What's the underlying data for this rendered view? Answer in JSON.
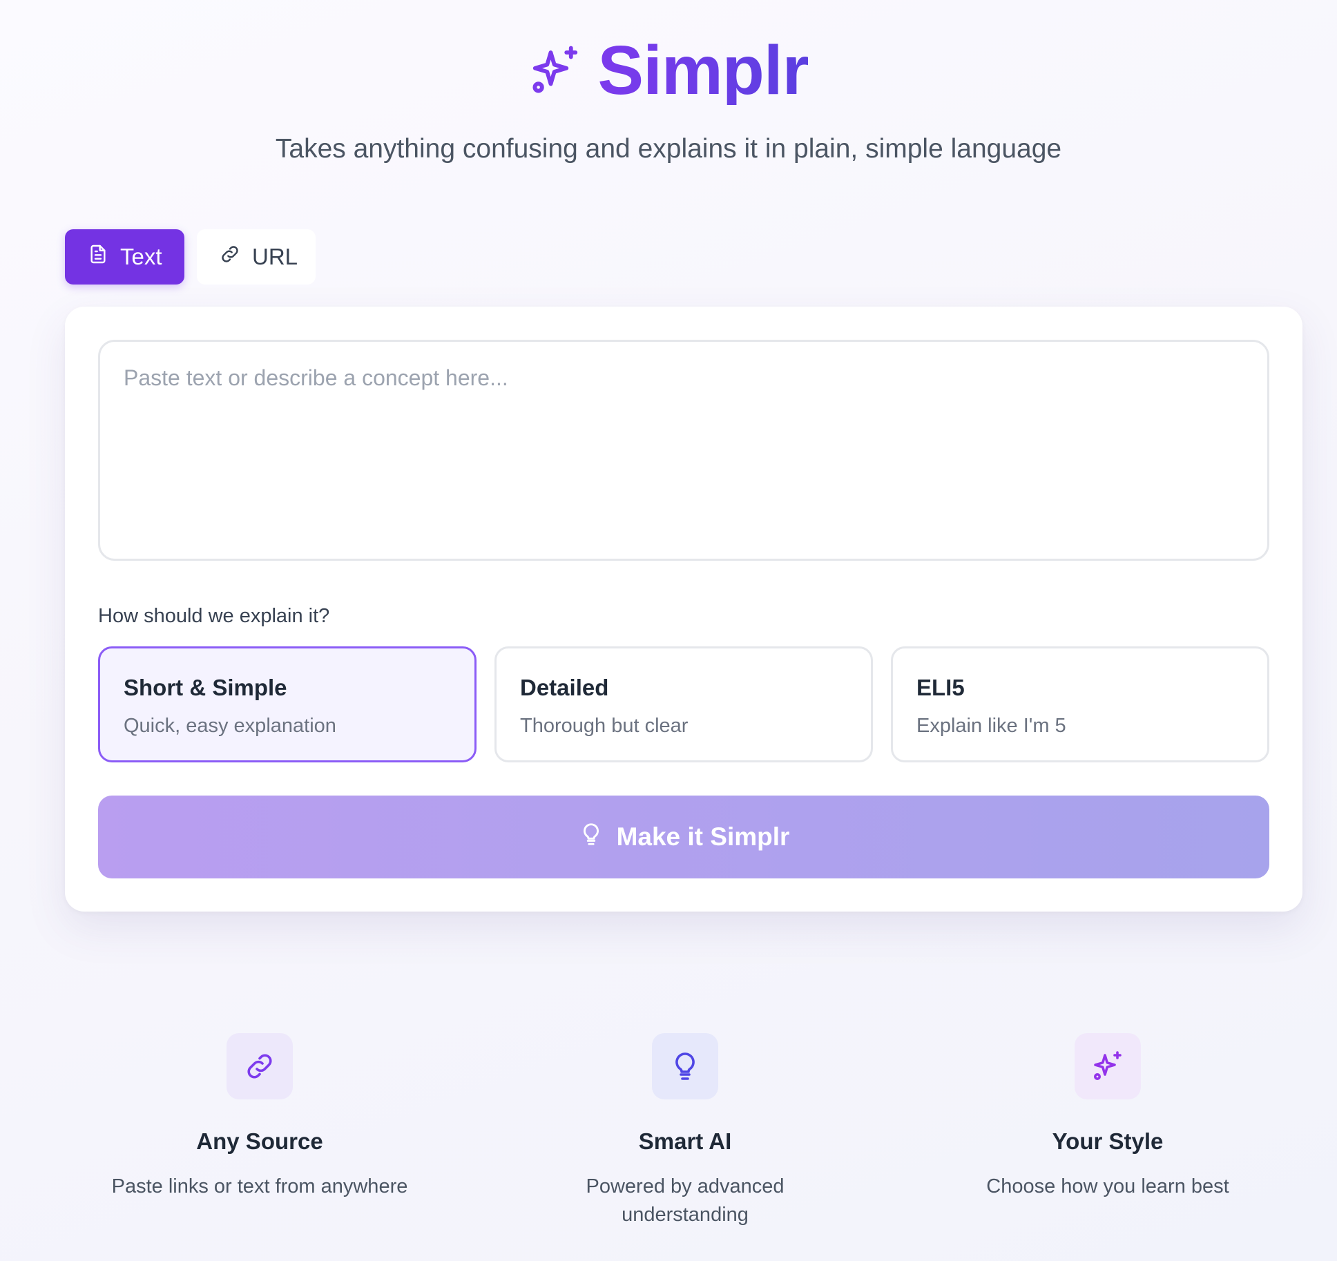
{
  "app": {
    "title": "Simplr",
    "subtitle": "Takes anything confusing and explains it in plain, simple language",
    "logo_icon": "sparkles-icon"
  },
  "tabs": [
    {
      "label": "Text",
      "icon": "document-icon",
      "active": true
    },
    {
      "label": "URL",
      "icon": "link-icon",
      "active": false
    }
  ],
  "input": {
    "value": "",
    "placeholder": "Paste text or describe a concept here..."
  },
  "style_question": "How should we explain it?",
  "options": [
    {
      "title": "Short & Simple",
      "desc": "Quick, easy explanation",
      "selected": true
    },
    {
      "title": "Detailed",
      "desc": "Thorough but clear",
      "selected": false
    },
    {
      "title": "ELI5",
      "desc": "Explain like I'm 5",
      "selected": false
    }
  ],
  "submit": {
    "label": "Make it Simplr",
    "icon": "lightbulb-icon"
  },
  "features": [
    {
      "title": "Any Source",
      "desc": "Paste links or text from anywhere",
      "icon": "link-icon",
      "bg": "#ede8fb",
      "color": "#7c3aed"
    },
    {
      "title": "Smart AI",
      "desc": "Powered by advanced understanding",
      "icon": "lightbulb-icon",
      "bg": "#e6e8fb",
      "color": "#4f46e5"
    },
    {
      "title": "Your Style",
      "desc": "Choose how you learn best",
      "icon": "sparkles-icon",
      "bg": "#f1e8fb",
      "color": "#9333ea"
    }
  ],
  "colors": {
    "brand": "#7433e3",
    "accent": "#8b5cf6",
    "button_gradient_start": "#b99ef0",
    "button_gradient_end": "#a7a3ec"
  }
}
